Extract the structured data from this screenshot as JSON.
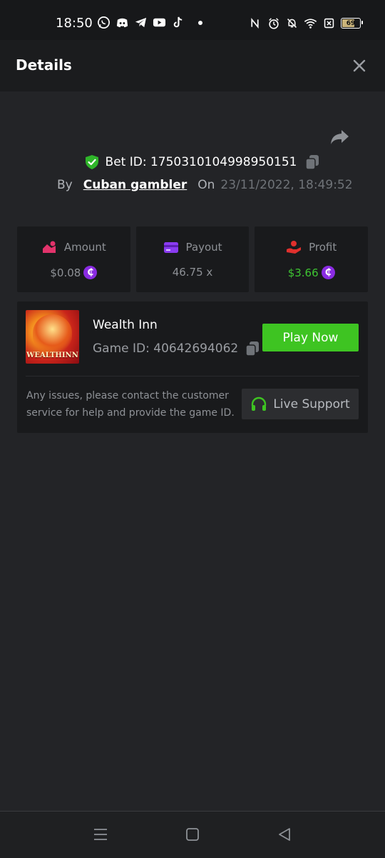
{
  "status_bar": {
    "time": "18:50",
    "app_icons": [
      "whatsapp-icon",
      "discord-icon",
      "telegram-icon",
      "youtube-icon",
      "tiktok-icon"
    ],
    "system_icons": [
      "nfc-icon",
      "alarm-icon",
      "mute-icon",
      "wifi-icon",
      "sim-off-icon"
    ],
    "battery_level": "69"
  },
  "header": {
    "title": "Details"
  },
  "bet": {
    "bet_id": "Bet ID: 1750310104998950151",
    "by_label": "By",
    "username": "Cuban gambler",
    "on_label": "On",
    "date": "23/11/2022, 18:49:52"
  },
  "stats": {
    "amount": {
      "label": "Amount",
      "value": "$0.08"
    },
    "payout": {
      "label": "Payout",
      "value": "46.75 x"
    },
    "profit": {
      "label": "Profit",
      "value": "$3.66"
    },
    "currency_symbol": "₵"
  },
  "game": {
    "name": "Wealth Inn",
    "game_id": "Game ID: 40642694062",
    "thumbnail_text": "WEALTHINN",
    "play_label": "Play Now",
    "help_text": "Any issues, please contact the customer service for help and provide the game ID.",
    "support_label": "Live Support"
  },
  "colors": {
    "accent_green": "#3ec422",
    "coin_purple": "#8a2be2",
    "background": "#232427",
    "card": "#191a1c"
  }
}
